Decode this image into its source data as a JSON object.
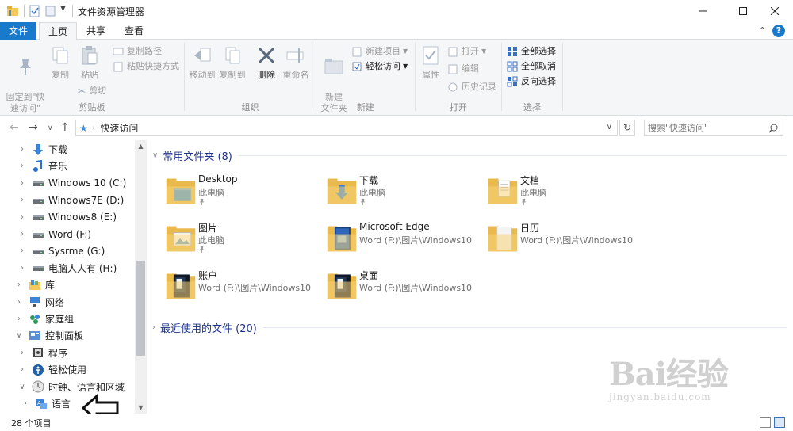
{
  "window": {
    "title": "文件资源管理器"
  },
  "tabs": {
    "file": "文件",
    "home": "主页",
    "share": "共享",
    "view": "查看"
  },
  "ribbon": {
    "clipboard": {
      "group": "剪贴板",
      "pin": "固定到\"快\n速访问\"",
      "copy": "复制",
      "paste": "粘贴",
      "copy_path": "复制路径",
      "paste_shortcut": "粘贴快捷方式",
      "cut": "剪切"
    },
    "organize": {
      "group": "组织",
      "move_to": "移动到",
      "copy_to": "复制到",
      "delete": "删除",
      "rename": "重命名"
    },
    "new": {
      "group": "新建",
      "new_folder": "新建\n文件夹",
      "new_item": "新建项目",
      "easy_access": "轻松访问"
    },
    "open": {
      "group": "打开",
      "properties": "属性",
      "open": "打开",
      "edit": "编辑",
      "history": "历史记录"
    },
    "select": {
      "group": "选择",
      "select_all": "全部选择",
      "select_none": "全部取消",
      "invert": "反向选择"
    }
  },
  "address": {
    "path": "快速访问",
    "search_placeholder": "搜索\"快速访问\""
  },
  "nav": [
    {
      "label": "下载",
      "indent": 1,
      "icon": "download-icon"
    },
    {
      "label": "音乐",
      "indent": 1,
      "icon": "music-icon"
    },
    {
      "label": "Windows 10 (C:)",
      "indent": 1,
      "icon": "drive-icon"
    },
    {
      "label": "Windows7E (D:)",
      "indent": 1,
      "icon": "drive-icon"
    },
    {
      "label": "Windows8 (E:)",
      "indent": 1,
      "icon": "drive-icon"
    },
    {
      "label": "Word (F:)",
      "indent": 1,
      "icon": "drive-icon"
    },
    {
      "label": "Sysrme (G:)",
      "indent": 1,
      "icon": "drive-icon"
    },
    {
      "label": "电脑人人有 (H:)",
      "indent": 1,
      "icon": "drive-icon"
    },
    {
      "label": "库",
      "indent": 0,
      "icon": "library-icon"
    },
    {
      "label": "网络",
      "indent": 0,
      "icon": "network-icon"
    },
    {
      "label": "家庭组",
      "indent": 0,
      "icon": "homegroup-icon"
    },
    {
      "label": "控制面板",
      "indent": 0,
      "icon": "control-panel-icon"
    },
    {
      "label": "程序",
      "indent": 1,
      "icon": "programs-icon"
    },
    {
      "label": "轻松使用",
      "indent": 1,
      "icon": "ease-of-access-icon"
    },
    {
      "label": "时钟、语言和区域",
      "indent": 1,
      "icon": "clock-icon"
    },
    {
      "label": "语言",
      "indent": 2,
      "icon": "language-icon"
    }
  ],
  "sections": {
    "frequent": "常用文件夹 (8)",
    "recent": "最近使用的文件 (20)"
  },
  "folders": [
    {
      "name": "Desktop",
      "sub": "此电脑",
      "pinned": true,
      "kind": "desktop"
    },
    {
      "name": "下载",
      "sub": "此电脑",
      "pinned": true,
      "kind": "download"
    },
    {
      "name": "文档",
      "sub": "此电脑",
      "pinned": true,
      "kind": "documents"
    },
    {
      "name": "图片",
      "sub": "此电脑",
      "pinned": true,
      "kind": "pictures"
    },
    {
      "name": "Microsoft Edge",
      "sub": "Word (F:)\\图片\\Windows10",
      "pinned": false,
      "kind": "photo"
    },
    {
      "name": "日历",
      "sub": "Word (F:)\\图片\\Windows10",
      "pinned": false,
      "kind": "white"
    },
    {
      "name": "账户",
      "sub": "Word (F:)\\图片\\Windows10",
      "pinned": false,
      "kind": "dark"
    },
    {
      "name": "桌面",
      "sub": "Word (F:)\\图片\\Windows10",
      "pinned": false,
      "kind": "dark"
    }
  ],
  "status": {
    "count": "28 个项目"
  },
  "watermark": {
    "main": "Bai经验",
    "sub": "jingyan.baidu.com"
  },
  "colors": {
    "accent": "#1979ca",
    "folder": "#f3c95c",
    "section_title": "#1e3287"
  }
}
